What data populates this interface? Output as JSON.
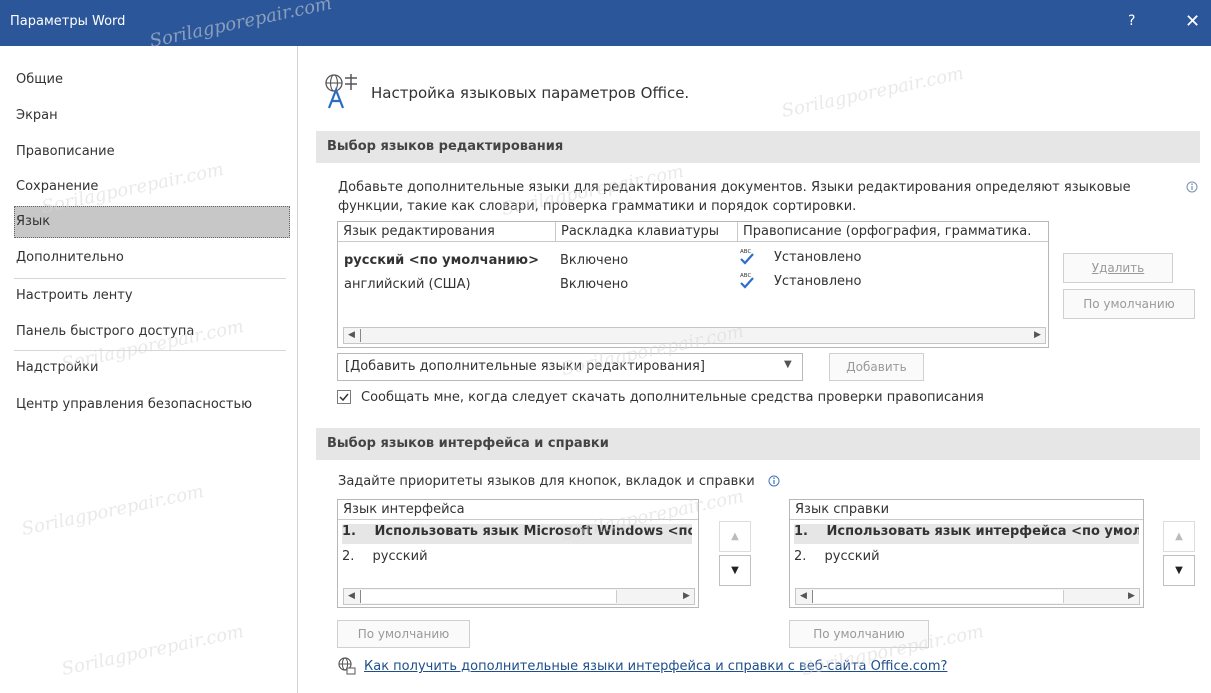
{
  "window": {
    "title": "Параметры Word",
    "help_glyph": "?",
    "close_glyph": "✕"
  },
  "nav": {
    "items": [
      {
        "label": "Общие"
      },
      {
        "label": "Экран"
      },
      {
        "label": "Правописание"
      },
      {
        "label": "Сохранение"
      },
      {
        "label": "Язык"
      },
      {
        "label": "Дополнительно"
      },
      {
        "label": "Настроить ленту"
      },
      {
        "label": "Панель быстрого доступа"
      },
      {
        "label": "Надстройки"
      },
      {
        "label": "Центр управления безопасностью"
      }
    ],
    "selected": "Язык"
  },
  "header": {
    "title": "Настройка языковых параметров Office."
  },
  "editing": {
    "section_title": "Выбор языков редактирования",
    "description_line1": "Добавьте дополнительные языки для редактирования документов. Языки редактирования определяют языковые",
    "description_line2": "функции, такие как словари, проверка грамматики и порядок сортировки.",
    "columns": [
      "Язык редактирования",
      "Раскладка клавиатуры",
      "Правописание (орфография, грамматика."
    ],
    "rows": [
      {
        "language": "русский <по умолчанию>",
        "keyboard": "Включено",
        "proofing": "Установлено",
        "bold": true
      },
      {
        "language": "английский (США)",
        "keyboard": "Включено",
        "proofing": "Установлено",
        "bold": false
      }
    ],
    "abc_label": "ABC",
    "remove_button": "Удалить",
    "default_button": "По умолчанию",
    "add_dropdown": "[Добавить дополнительные языки редактирования]",
    "add_button": "Добавить",
    "notify_checkbox": "Сообщать мне, когда следует скачать дополнительные средства проверки правописания",
    "notify_checked": true
  },
  "ui": {
    "section_title": "Выбор языков интерфейса и справки",
    "description": "Задайте приоритеты языков для кнопок, вкладок и справки",
    "interface_list": {
      "header": "Язык интерфейса",
      "items": [
        {
          "num": "1.",
          "label": "Использовать язык Microsoft Windows <по у",
          "bold": true
        },
        {
          "num": "2.",
          "label": "русский",
          "bold": false
        }
      ],
      "default_button": "По умолчанию"
    },
    "help_list": {
      "header": "Язык справки",
      "items": [
        {
          "num": "1.",
          "label": "Использовать язык интерфейса <по умол",
          "bold": true
        },
        {
          "num": "2.",
          "label": "русский",
          "bold": false
        }
      ],
      "default_button": "По умолчанию"
    },
    "link": "Как получить дополнительные языки интерфейса и справки с веб-сайта Office.com?"
  },
  "colors": {
    "titlebar": "#2b579a",
    "selected_nav": "#c7c7c7",
    "section_bg": "#e6e6e6",
    "link": "#1e4e8c",
    "check_blue": "#2e6fcb"
  },
  "watermark": "Sorilagporepair.com"
}
